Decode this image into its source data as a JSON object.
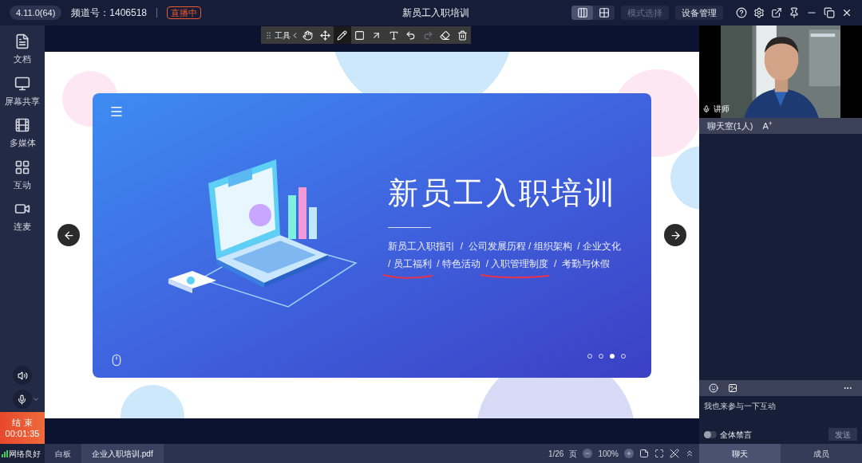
{
  "top_bar": {
    "version": "4.11.0(64)",
    "channel": "频道号：1406518",
    "live_badge": "直播中",
    "title": "新员工入职培训",
    "layouts": [
      {
        "kind": "speaker",
        "selected": true
      },
      {
        "kind": "grid",
        "selected": false
      }
    ],
    "mode_button": {
      "label": "模式选择",
      "disabled": true
    },
    "device_button": {
      "label": "设备管理",
      "disabled": false
    }
  },
  "toolbar": {
    "label": "工具",
    "tools": [
      {
        "kind": "hand",
        "selected": false
      },
      {
        "kind": "move",
        "selected": false
      },
      {
        "kind": "pen",
        "selected": true
      },
      {
        "kind": "rect",
        "selected": false
      },
      {
        "kind": "arrow",
        "selected": false
      },
      {
        "kind": "text",
        "selected": false
      },
      {
        "kind": "undo",
        "selected": false
      },
      {
        "kind": "redo",
        "selected": false
      },
      {
        "kind": "eraser",
        "selected": false
      },
      {
        "kind": "trash",
        "selected": false
      }
    ]
  },
  "sidebar": {
    "items": [
      {
        "kind": "document",
        "label": "文档"
      },
      {
        "kind": "screen",
        "label": "屏幕共享"
      },
      {
        "kind": "media",
        "label": "多媒体"
      },
      {
        "kind": "grid",
        "label": "互动"
      },
      {
        "kind": "camera",
        "label": "连麦"
      }
    ],
    "end_button": {
      "label": "结 束",
      "time": "00:01:35"
    },
    "network": "网络良好"
  },
  "slide": {
    "title": "新员工入职培训",
    "subtitle_lines": [
      "新员工入职指引  /  公司发展历程 / 组织架构  / 企业文化",
      "/ 员工福利  / 特色活动  / 入职管理制度  /  考勤与休假"
    ],
    "pages": [
      {
        "selected": false
      },
      {
        "selected": false
      },
      {
        "selected": true
      },
      {
        "selected": false
      }
    ]
  },
  "video": {
    "label": "讲师"
  },
  "chat": {
    "title": "聊天室(1人)",
    "font_button": "A$^{+}$",
    "message": "我也来参与一下互动",
    "mute_all": {
      "label": "全体禁言",
      "on": false
    },
    "send": "发送",
    "tabs": [
      {
        "label": "聊天",
        "selected": true
      },
      {
        "label": "成员",
        "selected": false
      }
    ]
  },
  "bottom_bar": {
    "tabs": [
      {
        "label": "白板",
        "selected": false
      },
      {
        "label": "企业入职培训.pdf",
        "selected": true
      }
    ],
    "page": "1/26",
    "page_unit": "页",
    "zoom": "100%"
  }
}
